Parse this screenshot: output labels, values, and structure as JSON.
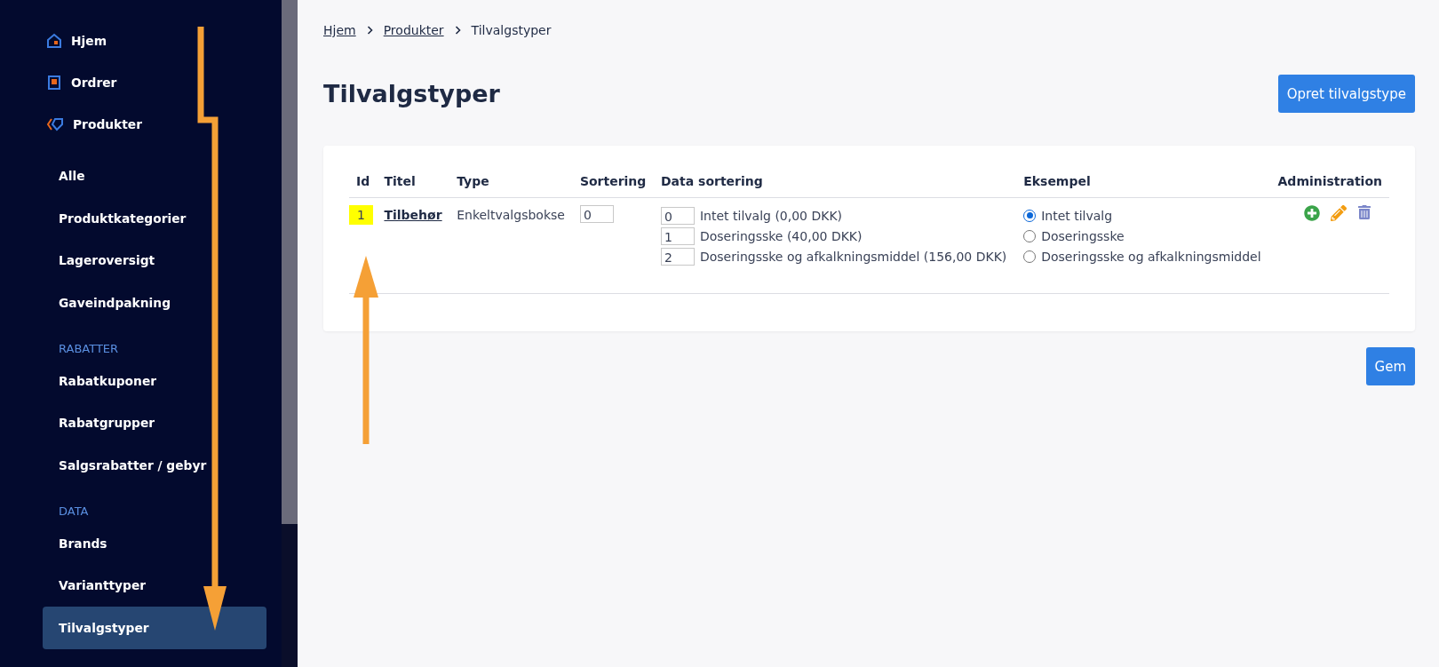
{
  "sidebar": {
    "items": [
      {
        "kind": "link",
        "label": "Hjem",
        "selected": false
      },
      {
        "kind": "link",
        "label": "Ordrer",
        "selected": false
      },
      {
        "kind": "link",
        "label": "Produkter",
        "selected": false
      },
      {
        "kind": "sub",
        "label": "Alle",
        "selected": false
      },
      {
        "kind": "sub",
        "label": "Produktkategorier",
        "selected": false
      },
      {
        "kind": "sub",
        "label": "Lageroversigt",
        "selected": false
      },
      {
        "kind": "sub",
        "label": "Gaveindpakning",
        "selected": false
      },
      {
        "kind": "heading",
        "label": "RABATTER"
      },
      {
        "kind": "sub",
        "label": "Rabatkuponer",
        "selected": false
      },
      {
        "kind": "sub",
        "label": "Rabatgrupper",
        "selected": false
      },
      {
        "kind": "sub",
        "label": "Salgsrabatter / gebyr",
        "selected": false
      },
      {
        "kind": "heading",
        "label": "DATA"
      },
      {
        "kind": "sub",
        "label": "Brands",
        "selected": false
      },
      {
        "kind": "sub",
        "label": "Varianttyper",
        "selected": false
      },
      {
        "kind": "sub",
        "label": "Tilvalgstyper",
        "selected": true
      }
    ]
  },
  "breadcrumb": [
    {
      "label": "Hjem",
      "link": true
    },
    {
      "label": "Produkter",
      "link": true
    },
    {
      "label": "Tilvalgstyper",
      "link": false
    }
  ],
  "page_title": "Tilvalgstyper",
  "create_button": "Opret tilvalgstype",
  "table": {
    "columns": [
      "Id",
      "Titel",
      "Type",
      "Sortering",
      "Data sortering",
      "Eksempel",
      "Administration"
    ],
    "rows": [
      {
        "id": "1",
        "id_highlighted": true,
        "title": "Tilbehør",
        "type": "Enkeltvalgsbokse",
        "sort": "0",
        "data": [
          {
            "sort": "0",
            "label": "Intet tilvalg (0,00 DKK)"
          },
          {
            "sort": "1",
            "label": "Doseringsske (40,00 DKK)"
          },
          {
            "sort": "2",
            "label": "Doseringsske og afkalkningsmiddel (156,00 DKK)"
          }
        ],
        "example": [
          {
            "label": "Intet tilvalg",
            "selected": true
          },
          {
            "label": "Doseringsske",
            "selected": false
          },
          {
            "label": "Doseringsske og afkalkningsmiddel",
            "selected": false
          }
        ]
      }
    ]
  },
  "save_button": "Gem"
}
